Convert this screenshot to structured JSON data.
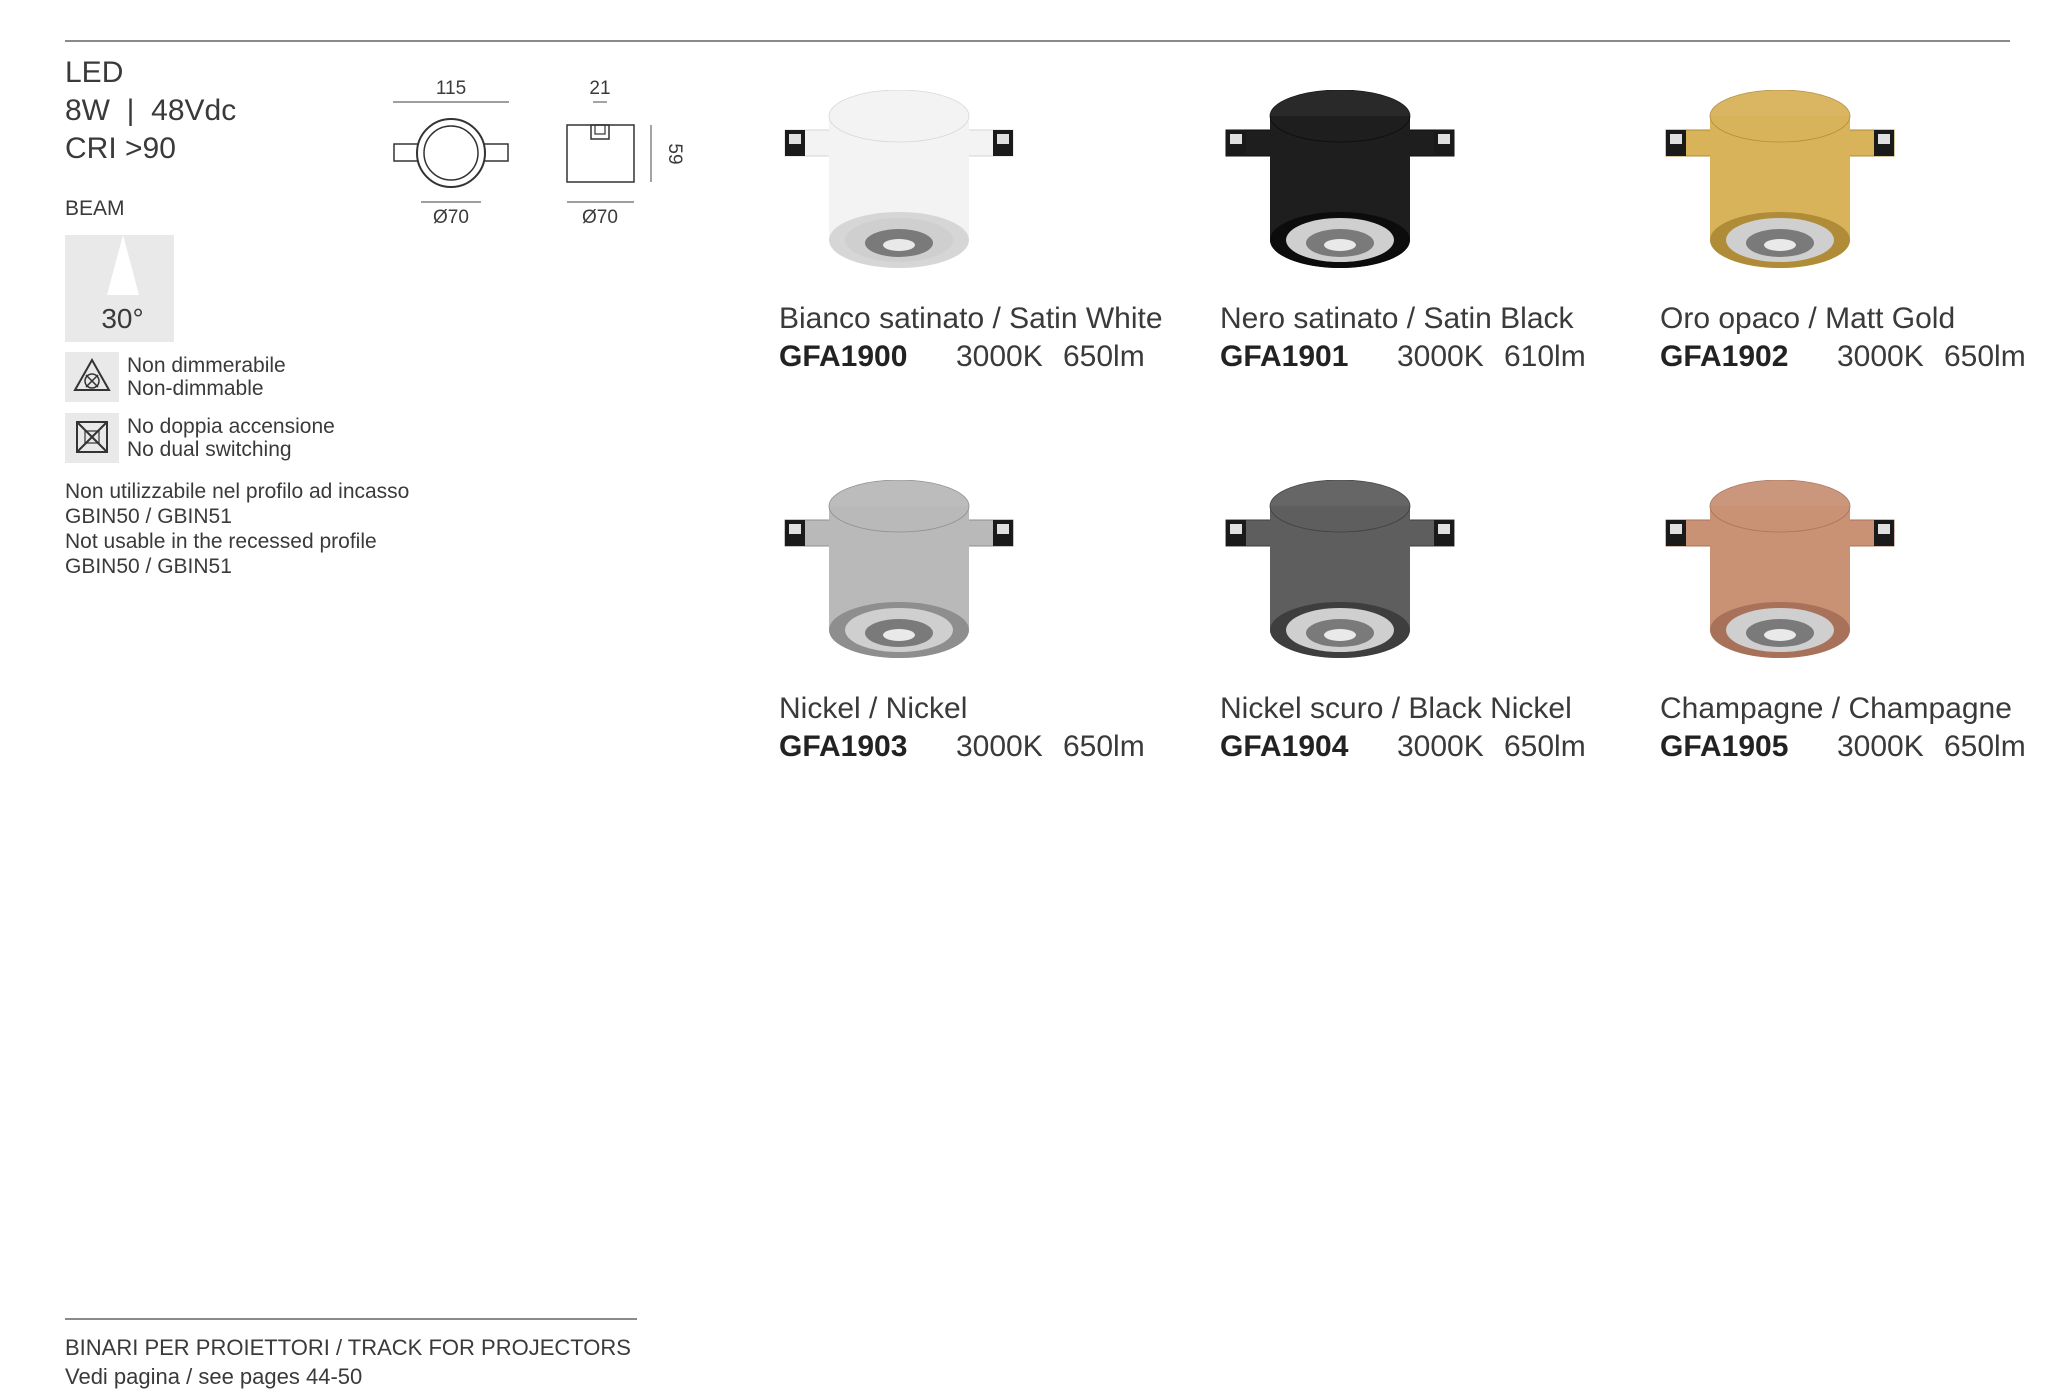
{
  "specs": {
    "line1": "LED",
    "line2": "8W  |  48Vdc",
    "line3": "CRI >90",
    "beam_label": "BEAM",
    "beam_angle": "30°"
  },
  "features": [
    {
      "icon": "non-dimmable-icon",
      "it": "Non dimmerabile",
      "en": "Non-dimmable"
    },
    {
      "icon": "no-dual-switching-icon",
      "it": "No doppia accensione",
      "en": "No dual switching"
    }
  ],
  "note": {
    "line1": "Non utilizzabile nel profilo ad incasso",
    "line2": "GBIN50 / GBIN51",
    "line3": "Not usable in the recessed profile",
    "line4": "GBIN50 / GBIN51"
  },
  "dimensions": {
    "width": "115",
    "diameter_front": "Ø70",
    "depth": "21",
    "height": "59",
    "diameter_side": "Ø70"
  },
  "products": [
    {
      "name": "Bianco satinato / Satin White",
      "code": "GFA1900",
      "temp": "3000K",
      "lumen": "650lm",
      "color": "#f3f3f3",
      "shade": "#d6d6d6"
    },
    {
      "name": "Nero satinato / Satin Black",
      "code": "GFA1901",
      "temp": "3000K",
      "lumen": "610lm",
      "color": "#1e1e1e",
      "shade": "#0c0c0c"
    },
    {
      "name": "Oro opaco / Matt Gold",
      "code": "GFA1902",
      "temp": "3000K",
      "lumen": "650lm",
      "color": "#d9b35a",
      "shade": "#b08b38"
    },
    {
      "name": "Nickel / Nickel",
      "code": "GFA1903",
      "temp": "3000K",
      "lumen": "650lm",
      "color": "#b9b9b9",
      "shade": "#8e8e8e"
    },
    {
      "name": "Nickel scuro / Black Nickel",
      "code": "GFA1904",
      "temp": "3000K",
      "lumen": "650lm",
      "color": "#5e5e5e",
      "shade": "#3e3e3e"
    },
    {
      "name": "Champagne / Champagne",
      "code": "GFA1905",
      "temp": "3000K",
      "lumen": "650lm",
      "color": "#c99275",
      "shade": "#a8715a"
    }
  ],
  "footer": {
    "line1": "BINARI PER PROIETTORI / TRACK FOR PROJECTORS",
    "line2": "Vedi pagina / see pages 44-50"
  }
}
